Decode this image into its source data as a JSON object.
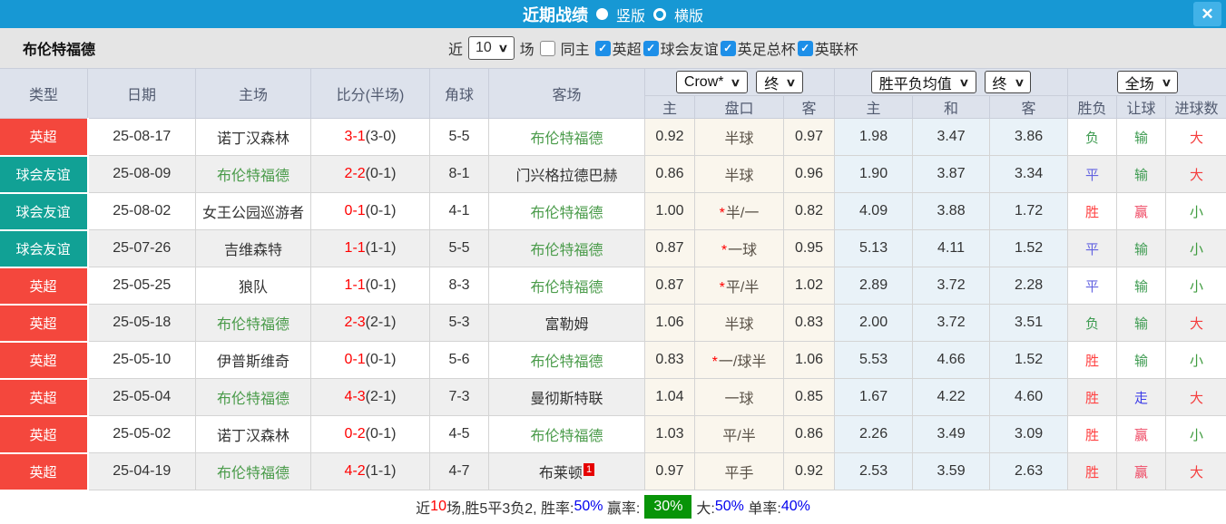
{
  "icons": {
    "close": "✕",
    "chevron": "∨",
    "check": "✓",
    "radio_selected": "filled-circle",
    "radio_unselected": "hollow-circle"
  },
  "colors": {
    "accent_blue": "#1798d4",
    "close_btn_blue": "#41b2e8",
    "filter_bg": "#e5e5e5",
    "header_bg": "#dde2ec",
    "badge_epl_red": "#f4473d",
    "badge_friendly_teal": "#11a195",
    "team_green": "#4a9b4a",
    "score_red": "#ff0000",
    "handicap_bg": "#faf6ed",
    "mean_bg": "#e9f2f8",
    "stripe_gray": "#efefef",
    "win_red": "#ff4242",
    "draw_blue": "#6363e0",
    "lose_green": "#3e9b51",
    "bet_win_red": "#ef4863",
    "push_blue": "#3c3ce8",
    "big_red": "#f43d3d",
    "small_green": "#3e9b3e",
    "green_box": "#089408",
    "checkbox_blue": "#1d8fe8",
    "link_blue": "#0000ee"
  },
  "titlebar": {
    "title": "近期战绩",
    "layout_options": [
      {
        "label": "竖版",
        "selected": true
      },
      {
        "label": "横版",
        "selected": false
      }
    ]
  },
  "filterbar": {
    "team": "布伦特福德",
    "recent_label": "近",
    "recent_value": "10",
    "matches_label": "场",
    "same_home_label": "同主",
    "same_home_checked": false,
    "leagues": [
      {
        "label": "英超",
        "checked": true
      },
      {
        "label": "球会友谊",
        "checked": true
      },
      {
        "label": "英足总杯",
        "checked": true
      },
      {
        "label": "英联杯",
        "checked": true
      }
    ]
  },
  "selects": {
    "bookmaker": "Crow*",
    "bookmaker_state": "终",
    "odds_mean": "胜平负均值",
    "odds_mean_state": "终",
    "period": "全场"
  },
  "table": {
    "headers": {
      "main": [
        "类型",
        "日期",
        "主场",
        "比分(半场)",
        "角球",
        "客场"
      ],
      "sub": [
        "主",
        "盘口",
        "客",
        "主",
        "和",
        "客",
        "胜负",
        "让球",
        "进球数"
      ]
    },
    "rows": [
      {
        "league": "英超",
        "type": "epl",
        "date": "25-08-17",
        "home": "诺丁汉森林",
        "home_hl": false,
        "score_ft": "3-1",
        "score_ht": "(3-0)",
        "corners": "5-5",
        "away": "布伦特福德",
        "away_hl": true,
        "away_rank": "",
        "odds_home": "0.92",
        "handicap_ast": false,
        "handicap": "半球",
        "odds_away": "0.97",
        "mean_home": "1.98",
        "mean_draw": "3.47",
        "mean_away": "3.86",
        "result": "负",
        "result_cls": "lose",
        "handicap_result": "输",
        "handicap_result_cls": "lose",
        "goals": "大",
        "goals_cls": "big"
      },
      {
        "league": "球会友谊",
        "type": "friendly",
        "date": "25-08-09",
        "home": "布伦特福德",
        "home_hl": true,
        "score_ft": "2-2",
        "score_ht": "(0-1)",
        "corners": "8-1",
        "away": "门兴格拉德巴赫",
        "away_hl": false,
        "away_rank": "",
        "odds_home": "0.86",
        "handicap_ast": false,
        "handicap": "半球",
        "odds_away": "0.96",
        "mean_home": "1.90",
        "mean_draw": "3.87",
        "mean_away": "3.34",
        "result": "平",
        "result_cls": "draw",
        "handicap_result": "输",
        "handicap_result_cls": "lose",
        "goals": "大",
        "goals_cls": "big"
      },
      {
        "league": "球会友谊",
        "type": "friendly",
        "date": "25-08-02",
        "home": "女王公园巡游者",
        "home_hl": false,
        "score_ft": "0-1",
        "score_ht": "(0-1)",
        "corners": "4-1",
        "away": "布伦特福德",
        "away_hl": true,
        "away_rank": "",
        "odds_home": "1.00",
        "handicap_ast": true,
        "handicap": "半/一",
        "odds_away": "0.82",
        "mean_home": "4.09",
        "mean_draw": "3.88",
        "mean_away": "1.72",
        "result": "胜",
        "result_cls": "win",
        "handicap_result": "赢",
        "handicap_result_cls": "hwin",
        "goals": "小",
        "goals_cls": "small"
      },
      {
        "league": "球会友谊",
        "type": "friendly",
        "date": "25-07-26",
        "home": "吉维森特",
        "home_hl": false,
        "score_ft": "1-1",
        "score_ht": "(1-1)",
        "corners": "5-5",
        "away": "布伦特福德",
        "away_hl": true,
        "away_rank": "",
        "odds_home": "0.87",
        "handicap_ast": true,
        "handicap": "一球",
        "odds_away": "0.95",
        "mean_home": "5.13",
        "mean_draw": "4.11",
        "mean_away": "1.52",
        "result": "平",
        "result_cls": "draw",
        "handicap_result": "输",
        "handicap_result_cls": "lose",
        "goals": "小",
        "goals_cls": "small"
      },
      {
        "league": "英超",
        "type": "epl",
        "date": "25-05-25",
        "home": "狼队",
        "home_hl": false,
        "score_ft": "1-1",
        "score_ht": "(0-1)",
        "corners": "8-3",
        "away": "布伦特福德",
        "away_hl": true,
        "away_rank": "",
        "odds_home": "0.87",
        "handicap_ast": true,
        "handicap": "平/半",
        "odds_away": "1.02",
        "mean_home": "2.89",
        "mean_draw": "3.72",
        "mean_away": "2.28",
        "result": "平",
        "result_cls": "draw",
        "handicap_result": "输",
        "handicap_result_cls": "lose",
        "goals": "小",
        "goals_cls": "small"
      },
      {
        "league": "英超",
        "type": "epl",
        "date": "25-05-18",
        "home": "布伦特福德",
        "home_hl": true,
        "score_ft": "2-3",
        "score_ht": "(2-1)",
        "corners": "5-3",
        "away": "富勒姆",
        "away_hl": false,
        "away_rank": "",
        "odds_home": "1.06",
        "handicap_ast": false,
        "handicap": "半球",
        "odds_away": "0.83",
        "mean_home": "2.00",
        "mean_draw": "3.72",
        "mean_away": "3.51",
        "result": "负",
        "result_cls": "lose",
        "handicap_result": "输",
        "handicap_result_cls": "lose",
        "goals": "大",
        "goals_cls": "big"
      },
      {
        "league": "英超",
        "type": "epl",
        "date": "25-05-10",
        "home": "伊普斯维奇",
        "home_hl": false,
        "score_ft": "0-1",
        "score_ht": "(0-1)",
        "corners": "5-6",
        "away": "布伦特福德",
        "away_hl": true,
        "away_rank": "",
        "odds_home": "0.83",
        "handicap_ast": true,
        "handicap": "一/球半",
        "odds_away": "1.06",
        "mean_home": "5.53",
        "mean_draw": "4.66",
        "mean_away": "1.52",
        "result": "胜",
        "result_cls": "win",
        "handicap_result": "输",
        "handicap_result_cls": "lose",
        "goals": "小",
        "goals_cls": "small"
      },
      {
        "league": "英超",
        "type": "epl",
        "date": "25-05-04",
        "home": "布伦特福德",
        "home_hl": true,
        "score_ft": "4-3",
        "score_ht": "(2-1)",
        "corners": "7-3",
        "away": "曼彻斯特联",
        "away_hl": false,
        "away_rank": "",
        "odds_home": "1.04",
        "handicap_ast": false,
        "handicap": "一球",
        "odds_away": "0.85",
        "mean_home": "1.67",
        "mean_draw": "4.22",
        "mean_away": "4.60",
        "result": "胜",
        "result_cls": "win",
        "handicap_result": "走",
        "handicap_result_cls": "push",
        "goals": "大",
        "goals_cls": "big"
      },
      {
        "league": "英超",
        "type": "epl",
        "date": "25-05-02",
        "home": "诺丁汉森林",
        "home_hl": false,
        "score_ft": "0-2",
        "score_ht": "(0-1)",
        "corners": "4-5",
        "away": "布伦特福德",
        "away_hl": true,
        "away_rank": "",
        "odds_home": "1.03",
        "handicap_ast": false,
        "handicap": "平/半",
        "odds_away": "0.86",
        "mean_home": "2.26",
        "mean_draw": "3.49",
        "mean_away": "3.09",
        "result": "胜",
        "result_cls": "win",
        "handicap_result": "赢",
        "handicap_result_cls": "hwin",
        "goals": "小",
        "goals_cls": "small"
      },
      {
        "league": "英超",
        "type": "epl",
        "date": "25-04-19",
        "home": "布伦特福德",
        "home_hl": true,
        "score_ft": "4-2",
        "score_ht": "(1-1)",
        "corners": "4-7",
        "away": "布莱顿",
        "away_hl": false,
        "away_rank": "1",
        "odds_home": "0.97",
        "handicap_ast": false,
        "handicap": "平手",
        "odds_away": "0.92",
        "mean_home": "2.53",
        "mean_draw": "3.59",
        "mean_away": "2.63",
        "result": "胜",
        "result_cls": "win",
        "handicap_result": "赢",
        "handicap_result_cls": "hwin",
        "goals": "大",
        "goals_cls": "big"
      }
    ]
  },
  "footer": {
    "segments": [
      {
        "text": "近",
        "cls": "plain"
      },
      {
        "text": "10",
        "cls": "red"
      },
      {
        "text": "场,胜5平3负2, 胜率:",
        "cls": "plain"
      },
      {
        "text": "50%",
        "cls": "blue"
      },
      {
        "text": " 赢率:",
        "cls": "plain"
      },
      {
        "text": "30%",
        "cls": "greenbox"
      },
      {
        "text": "大:",
        "cls": "plain"
      },
      {
        "text": "50%",
        "cls": "blue"
      },
      {
        "text": " 单率:",
        "cls": "plain"
      },
      {
        "text": "40%",
        "cls": "blue"
      }
    ]
  }
}
